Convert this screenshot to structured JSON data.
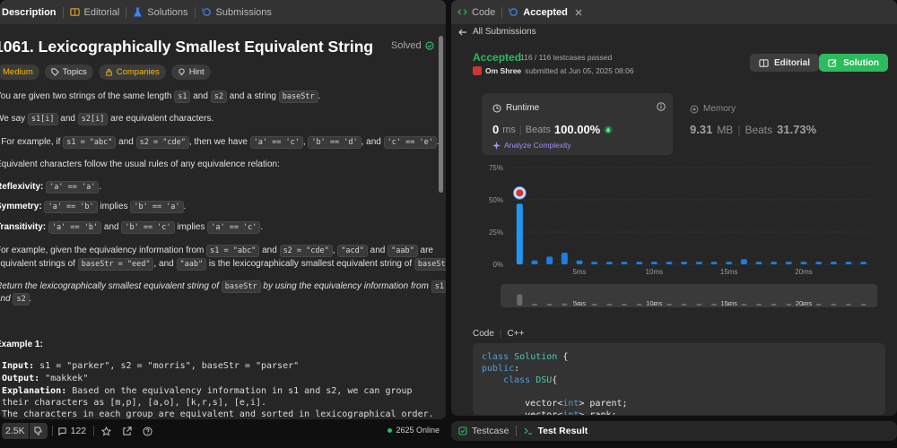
{
  "left": {
    "tabs": [
      {
        "label": "Description"
      },
      {
        "label": "Editorial"
      },
      {
        "label": "Solutions"
      },
      {
        "label": "Submissions"
      }
    ],
    "title": "1061. Lexicographically Smallest Equivalent String",
    "solved": "Solved",
    "chips": [
      "Medium",
      "Topics",
      "Companies",
      "Hint"
    ],
    "p1": {
      "a": "You are given two strings of the same length ",
      "c1": "s1",
      "b": " and ",
      "c2": "s2",
      "c": " and a string ",
      "c3": "baseStr",
      "d": "."
    },
    "p2": {
      "a": "We say ",
      "c1": "s1[i]",
      "b": " and ",
      "c2": "s2[i]",
      "c": " are equivalent characters."
    },
    "p3": {
      "bullet": "•",
      "a": " For example, if ",
      "c1": "s1 = \"abc\"",
      "b": " and ",
      "c2": "s2 = \"cde\"",
      "c": ", then we have ",
      "c3": "'a' == 'c'",
      "d": ", ",
      "c4": "'b' == 'd'",
      "e": ", and ",
      "c5": "'c' == 'e'",
      "f": "."
    },
    "p4": "Equivalent characters follow the usual rules of any equivalence relation:",
    "rules": [
      {
        "name": "Reflexivity:",
        "c1": "'a' == 'a'",
        "tail": "."
      },
      {
        "name": "Symmetry:",
        "c1": "'a' == 'b'",
        "mid": " implies ",
        "c2": "'b' == 'a'",
        "tail": "."
      },
      {
        "name": "Transitivity:",
        "c1": "'a' == 'b'",
        "mid": " and ",
        "c2": "'b' == 'c'",
        "mid2": " implies ",
        "c3": "'a' == 'c'",
        "tail": "."
      }
    ],
    "p5": {
      "a": "For example, given the equivalency information from ",
      "c1": "s1 = \"abc\"",
      "b": " and ",
      "c2": "s2 = \"cde\"",
      "c": ", ",
      "c3": "\"acd\"",
      "d": " and ",
      "c4": "\"aab\"",
      "e": " are"
    },
    "p6": {
      "a": "equivalent strings of ",
      "c1": "baseStr = \"eed\"",
      "b": ", and ",
      "c2": "\"aab\"",
      "c": " is the lexicographically smallest equivalent string of ",
      "c3": "baseStr",
      "d": "."
    },
    "p7": {
      "a": "Return the lexicographically smallest equivalent string of ",
      "c1": "baseStr",
      "b": " by using the equivalency information from ",
      "c2": "s1"
    },
    "p8": {
      "a": "and ",
      "c1": "s2",
      "b": "."
    },
    "example_title": "Example 1:",
    "example": {
      "input_label": "Input:",
      "input": " s1 = \"parker\", s2 = \"morris\", baseStr = \"parser\"",
      "output_label": "Output:",
      "output": " \"makkek\"",
      "expl_label": "Explanation:",
      "expl1": " Based on the equivalency information in s1 and s2, we can group",
      "expl2": "their characters as [m,p], [a,o], [k,r,s], [e,i].",
      "expl3": "The characters in each group are equivalent and sorted in lexicographical order."
    },
    "bottom": {
      "likes": "2.5K",
      "comments": "122",
      "online": "2625 Online"
    }
  },
  "right": {
    "tabs": [
      {
        "label": "Code"
      },
      {
        "label": "Accepted"
      }
    ],
    "back": "All Submissions",
    "status": "Accepted",
    "testcases": "116 / 116 testcases passed",
    "user": "Om Shree",
    "submitted": "submitted at Jun 05, 2025 08:06",
    "editorial_btn": "Editorial",
    "solution_btn": "Solution",
    "runtime": {
      "label": "Runtime",
      "value": "0",
      "unit": "ms",
      "beats_label": "Beats",
      "beats": "100.00%",
      "analyze": "Analyze Complexity"
    },
    "memory": {
      "label": "Memory",
      "value": "9.31",
      "unit": "MB",
      "beats_label": "Beats",
      "beats": "31.73%"
    },
    "code_header": {
      "label": "Code",
      "lang": "C++"
    },
    "code_lines": [
      "class Solution {",
      "public:",
      "    class DSU{",
      "",
      "        vector<int> parent;",
      "        vector<int> rank;"
    ],
    "bottom": {
      "testcase": "Testcase",
      "result": "Test Result"
    }
  },
  "chart_data": {
    "type": "bar",
    "ylabel_ticks": [
      "75%",
      "50%",
      "25%",
      "0%"
    ],
    "ylim": [
      0,
      75
    ],
    "x_ticks": [
      "5ms",
      "10ms",
      "15ms",
      "20ms"
    ],
    "x": [
      0,
      1,
      2,
      3,
      4,
      5,
      6,
      7,
      8,
      9,
      10,
      11,
      12,
      13,
      14,
      15,
      16,
      17,
      18,
      19,
      20,
      21,
      22,
      23
    ],
    "values": [
      47,
      3,
      6,
      9,
      3,
      2,
      2,
      2,
      2,
      2,
      2,
      2,
      2,
      2,
      2,
      4,
      2,
      2,
      2,
      2,
      2,
      2,
      2,
      2
    ],
    "highlight_index": 0,
    "colors": {
      "bar": "#1a7fe0",
      "highlight": "#2196f3",
      "grid": "#444444"
    },
    "grid": true,
    "minimap_ticks": [
      "5ms",
      "10ms",
      "15ms",
      "20ms"
    ]
  }
}
